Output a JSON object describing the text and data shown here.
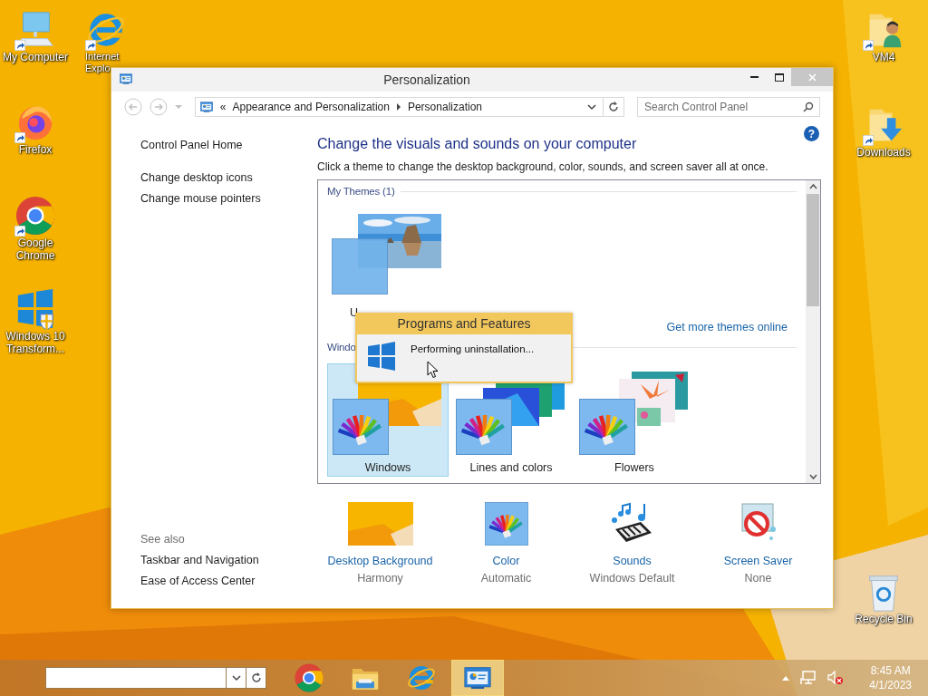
{
  "desktop_icons": [
    {
      "label": "My Computer",
      "kind": "computer",
      "shortcut": true
    },
    {
      "label": "Internet Explo",
      "kind": "ie",
      "shortcut": true
    },
    {
      "label": "Firefox",
      "kind": "firefox",
      "shortcut": true
    },
    {
      "label": "Google Chrome",
      "kind": "chrome",
      "shortcut": true
    },
    {
      "label": "Windows 10 Transform...",
      "kind": "windows",
      "shortcut": false
    },
    {
      "label": "VM4",
      "kind": "user-folder",
      "shortcut": true
    },
    {
      "label": "Downloads",
      "kind": "downloads-folder",
      "shortcut": true
    },
    {
      "label": "Recycle Bin",
      "kind": "recycle-bin",
      "shortcut": false
    }
  ],
  "window": {
    "title": "Personalization",
    "address": {
      "overflow_mark": "«",
      "crumbs": [
        "Appearance and Personalization",
        "Personalization"
      ]
    },
    "search": {
      "placeholder": "Search Control Panel"
    },
    "help": "?",
    "sidebar": {
      "links": [
        "Control Panel Home",
        "Change desktop icons",
        "Change mouse pointers"
      ],
      "see_also": {
        "heading": "See also",
        "links": [
          "Taskbar and Navigation",
          "Ease of Access Center"
        ]
      }
    },
    "heading": "Change the visuals and sounds on your computer",
    "description": "Click a theme to change the desktop background, color, sounds, and screen saver all at once.",
    "theme_groups": [
      {
        "title": "My Themes (1)",
        "themes": [
          {
            "label": "U",
            "selected": false
          }
        ],
        "link": "Get more themes online"
      },
      {
        "title": "Windo",
        "themes": [
          {
            "label": "Windows",
            "kind": "windows",
            "selected": true
          },
          {
            "label": "Lines and colors",
            "kind": "lines",
            "selected": false
          },
          {
            "label": "Flowers",
            "kind": "flowers",
            "selected": false
          }
        ]
      }
    ],
    "settings": [
      {
        "label": "Desktop Background",
        "value": "Harmony",
        "kind": "background"
      },
      {
        "label": "Color",
        "value": "Automatic",
        "kind": "color"
      },
      {
        "label": "Sounds",
        "value": "Windows Default",
        "kind": "sounds"
      },
      {
        "label": "Screen Saver",
        "value": "None",
        "kind": "screensaver"
      }
    ]
  },
  "dialog": {
    "title": "Programs and Features",
    "message": "Performing uninstallation..."
  },
  "taskbar": {
    "apps": [
      {
        "kind": "chrome",
        "active": false
      },
      {
        "kind": "explorer",
        "active": false
      },
      {
        "kind": "ie",
        "active": false
      },
      {
        "kind": "control-panel",
        "active": true
      }
    ],
    "time": "8:45 AM",
    "date": "4/1/2023"
  }
}
